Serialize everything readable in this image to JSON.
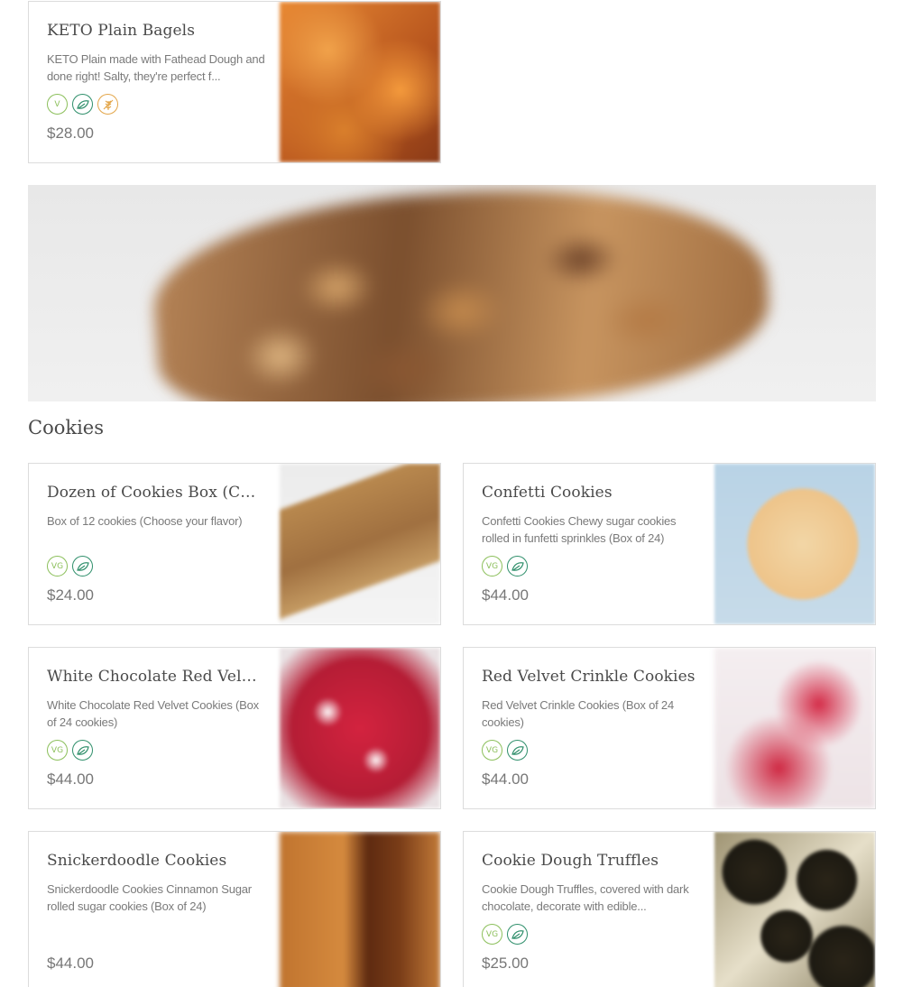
{
  "section": {
    "title": "Cookies"
  },
  "items": [
    {
      "title": "KETO Plain Bagels",
      "description": "KETO Plain made with Fathead Dough and done right! Salty, they're perfect f...",
      "price": "$28.00",
      "badges": [
        "vegetarian-icon",
        "vegan-leaf-icon",
        "gluten-free-icon"
      ],
      "badge_labels": {
        "vegetarian": "V",
        "vegetarian_vg": "VG"
      }
    },
    {
      "title": "Dozen of Cookies Box (Cho...",
      "description": "Box of 12 cookies (Choose your flavor)",
      "price": "$24.00",
      "badges": [
        "vg-icon",
        "vegan-leaf-icon"
      ]
    },
    {
      "title": "Confetti Cookies",
      "description": "Confetti Cookies Chewy sugar cookies rolled in funfetti sprinkles (Box of 24)",
      "price": "$44.00",
      "badges": [
        "vg-icon",
        "vegan-leaf-icon"
      ]
    },
    {
      "title": "White Chocolate Red Velve...",
      "description": "White Chocolate Red Velvet Cookies (Box of 24 cookies)",
      "price": "$44.00",
      "badges": [
        "vg-icon",
        "vegan-leaf-icon"
      ]
    },
    {
      "title": "Red Velvet Crinkle Cookies",
      "description": "Red Velvet Crinkle Cookies (Box of 24 cookies)",
      "price": "$44.00",
      "badges": [
        "vg-icon",
        "vegan-leaf-icon"
      ]
    },
    {
      "title": "Snickerdoodle Cookies",
      "description": "Snickerdoodle Cookies Cinnamon Sugar rolled sugar cookies (Box of 24)",
      "price": "$44.00",
      "badges": []
    },
    {
      "title": "Cookie Dough Truffles",
      "description": "Cookie Dough Truffles, covered with dark chocolate, decorate with edible...",
      "price": "$25.00",
      "badges": [
        "vg-icon",
        "vegan-leaf-icon"
      ]
    }
  ],
  "colors": {
    "vegetarian": "#8bbf5a",
    "vegan": "#2f8f6b",
    "gluten_free": "#e3a64a"
  }
}
